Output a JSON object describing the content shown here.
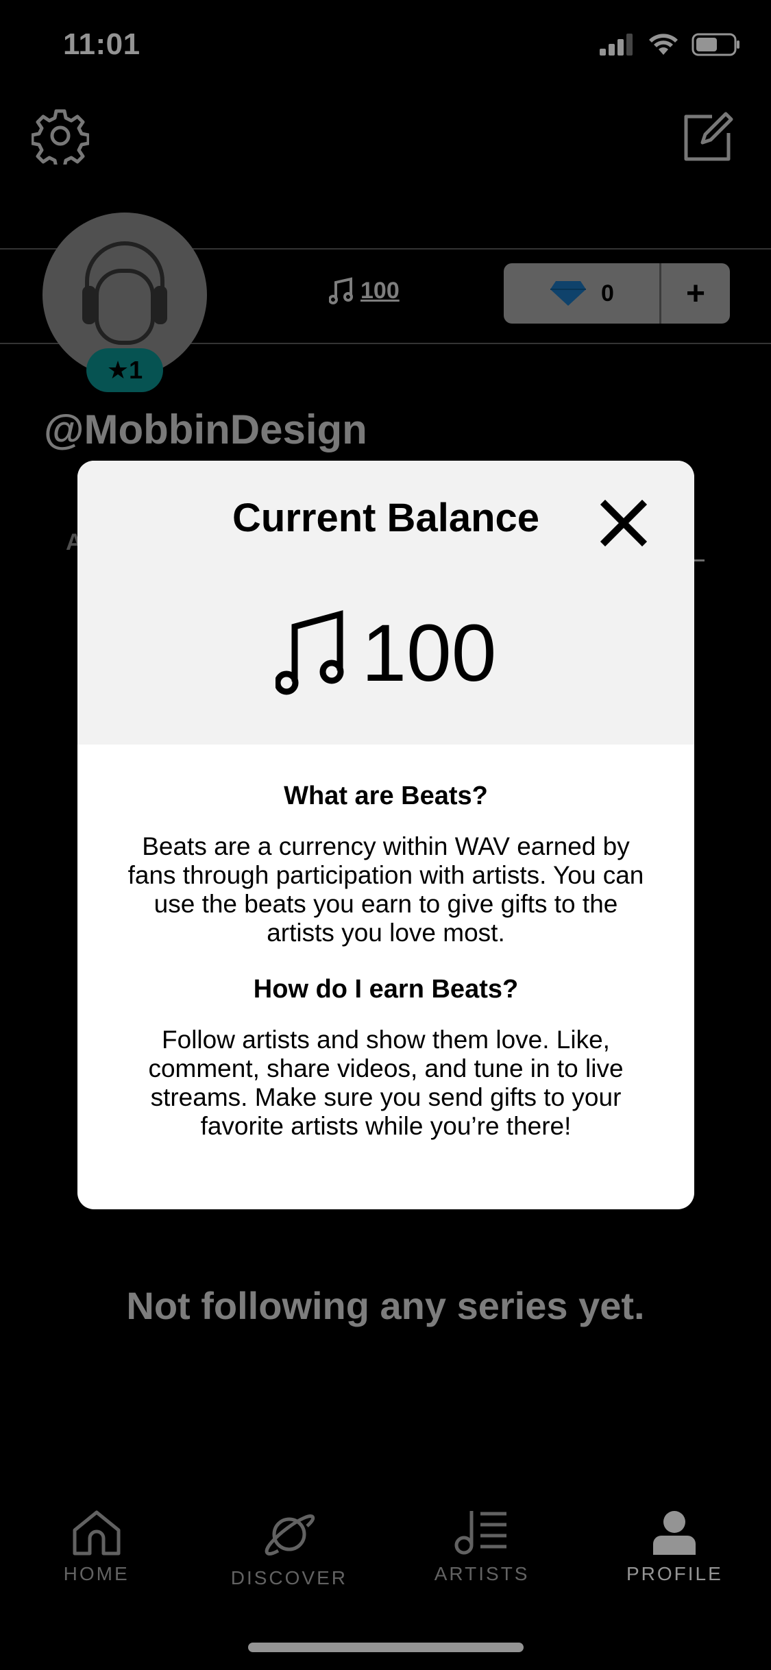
{
  "status_bar": {
    "time": "11:01"
  },
  "profile": {
    "beats": "100",
    "gems": "0",
    "gems_add": "+",
    "level": "★1",
    "username": "@MobbinDesign",
    "tab_peek": "A",
    "empty_message": "Not following any series yet."
  },
  "modal": {
    "title": "Current Balance",
    "balance": "100",
    "q1_title": "What are Beats?",
    "q1_body": "Beats are a currency within WAV earned by fans through participation with artists. You can use the beats you earn to give gifts to the artists you love most.",
    "q2_title": "How do I earn Beats?",
    "q2_body": "Follow artists and show them love. Like, comment, share videos, and tune in to live streams. Make sure you send gifts to your favorite artists while you’re there!"
  },
  "tabbar": {
    "items": [
      {
        "label": "HOME",
        "icon": "home-icon"
      },
      {
        "label": "DISCOVER",
        "icon": "planet-icon"
      },
      {
        "label": "ARTISTS",
        "icon": "music-list-icon"
      },
      {
        "label": "PROFILE",
        "icon": "person-icon"
      }
    ],
    "active": "PROFILE"
  },
  "colors": {
    "badge": "#0b8f8e",
    "gem": "#1a73b8",
    "background": "#000000"
  }
}
